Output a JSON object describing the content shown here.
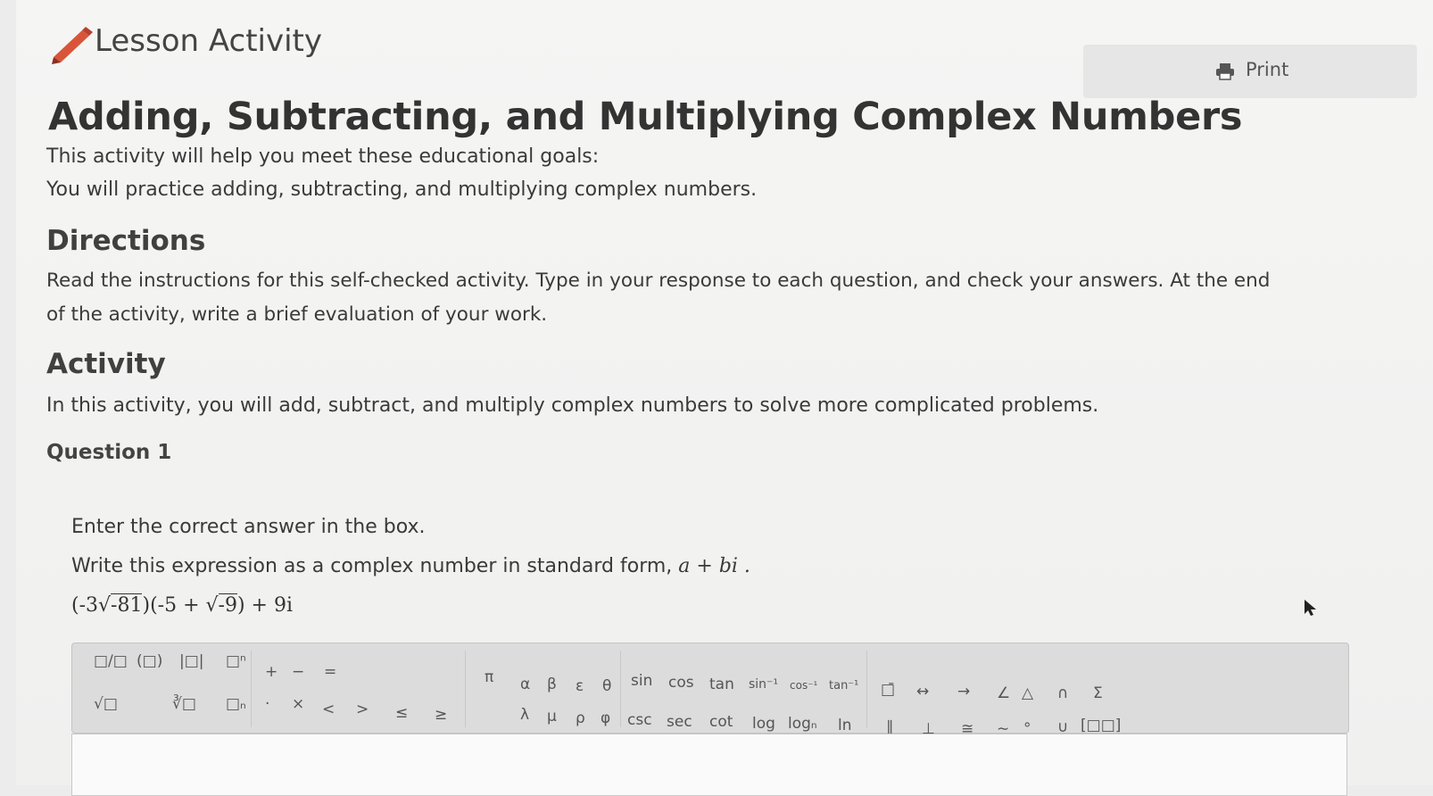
{
  "header": {
    "lesson_label": "Lesson Activity",
    "print_label": "Print",
    "pencil_color": "#d9553a"
  },
  "title": "Adding, Subtracting, and Multiplying Complex Numbers",
  "intro": {
    "line1": "This activity will help you meet these educational goals:",
    "line2": "You will practice adding, subtracting, and multiplying complex numbers."
  },
  "directions": {
    "heading": "Directions",
    "line1": "Read the instructions for this self-checked activity. Type in your response to each question, and check your answers. At the end",
    "line2": "of the activity, write a brief evaluation of your work."
  },
  "activity": {
    "heading": "Activity",
    "text": "In this activity, you will add, subtract, and multiply complex numbers to solve more complicated problems."
  },
  "question": {
    "label": "Question 1",
    "instruction": "Enter the correct answer in the box.",
    "prompt": "Write this expression as a complex number in standard form,",
    "form": "a + bi .",
    "expr_a": "(-3",
    "expr_rad1": "-81",
    "expr_b": ")(-5 + ",
    "expr_rad2": "-9",
    "expr_c": ") + 9i"
  },
  "toolbar": {
    "group1_top": [
      "□/□",
      "(□)",
      "|□|",
      "□ⁿ"
    ],
    "group1_bottom": [
      "√□",
      "∛□",
      "□ₙ"
    ],
    "ops_top": [
      "+",
      "−",
      "="
    ],
    "ops_bottom": [
      "·",
      "×",
      "<",
      ">",
      "≤",
      "≥"
    ],
    "greek_top": [
      "π",
      "α",
      "β",
      "ε",
      "θ"
    ],
    "greek_bottom": [
      "λ",
      "μ",
      "ρ",
      "φ"
    ],
    "trig_top": [
      "sin",
      "cos",
      "tan",
      "sin⁻¹",
      "cos⁻¹",
      "tan⁻¹"
    ],
    "trig_bottom": [
      "csc",
      "sec",
      "cot",
      "log",
      "logₙ",
      "ln"
    ],
    "geo_top": [
      "□̄",
      "↔",
      "→",
      "∠",
      "△",
      "∩",
      "Σ"
    ],
    "geo_bottom": [
      "∥",
      "⊥",
      "≅",
      "∼",
      "°",
      "∪",
      "[□□]"
    ]
  }
}
